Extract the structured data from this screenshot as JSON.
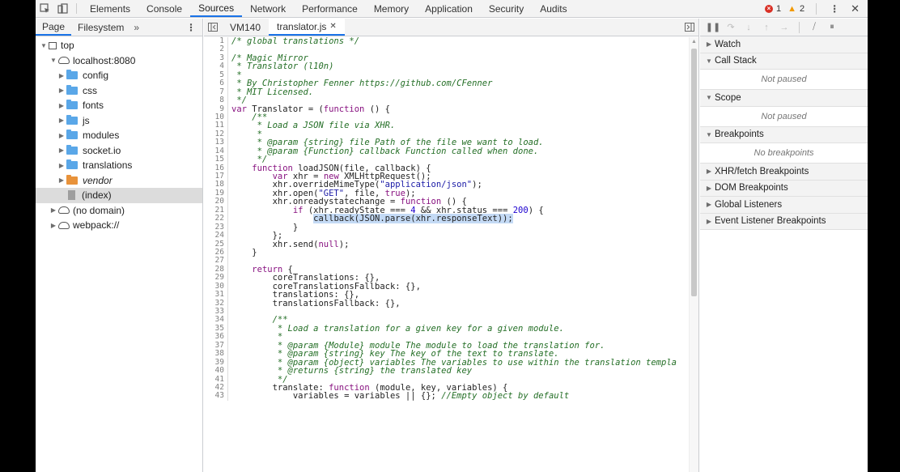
{
  "toolbar": {
    "tabs": [
      "Elements",
      "Console",
      "Sources",
      "Network",
      "Performance",
      "Memory",
      "Application",
      "Security",
      "Audits"
    ],
    "errors": "1",
    "warnings": "2"
  },
  "navigator": {
    "tabs": [
      "Page",
      "Filesystem"
    ],
    "more": "»",
    "tree": {
      "top": "top",
      "origin": "localhost:8080",
      "folders": [
        "config",
        "css",
        "fonts",
        "js",
        "modules",
        "socket.io",
        "translations",
        "vendor"
      ],
      "index": "(index)",
      "no_domain": "(no domain)",
      "webpack": "webpack://"
    }
  },
  "editor": {
    "tabs": [
      "VM140",
      "translator.js"
    ],
    "lines": [
      "/* global translations */",
      "",
      "/* Magic Mirror",
      " * Translator (l10n)",
      " *",
      " * By Christopher Fenner https://github.com/CFenner",
      " * MIT Licensed.",
      " */",
      "var Translator = (function () {",
      "    /**",
      "     * Load a JSON file via XHR.",
      "     *",
      "     * @param {string} file Path of the file we want to load.",
      "     * @param {Function} callback Function called when done.",
      "     */",
      "    function loadJSON(file, callback) {",
      "        var xhr = new XMLHttpRequest();",
      "        xhr.overrideMimeType(\"application/json\");",
      "        xhr.open(\"GET\", file, true);",
      "        xhr.onreadystatechange = function () {",
      "            if (xhr.readyState === 4 && xhr.status === 200) {",
      "                callback(JSON.parse(xhr.responseText));",
      "            }",
      "        };",
      "        xhr.send(null);",
      "    }",
      "",
      "    return {",
      "        coreTranslations: {},",
      "        coreTranslationsFallback: {},",
      "        translations: {},",
      "        translationsFallback: {},",
      "",
      "        /**",
      "         * Load a translation for a given key for a given module.",
      "         *",
      "         * @param {Module} module The module to load the translation for.",
      "         * @param {string} key The key of the text to translate.",
      "         * @param {object} variables The variables to use within the translation templa",
      "         * @returns {string} the translated key",
      "         */",
      "        translate: function (module, key, variables) {",
      "            variables = variables || {}; //Empty object by default"
    ]
  },
  "debugger": {
    "panes": [
      {
        "title": "Watch",
        "expanded": false,
        "body": ""
      },
      {
        "title": "Call Stack",
        "expanded": true,
        "body": "Not paused"
      },
      {
        "title": "Scope",
        "expanded": true,
        "body": "Not paused"
      },
      {
        "title": "Breakpoints",
        "expanded": true,
        "body": "No breakpoints"
      },
      {
        "title": "XHR/fetch Breakpoints",
        "expanded": false,
        "body": ""
      },
      {
        "title": "DOM Breakpoints",
        "expanded": false,
        "body": ""
      },
      {
        "title": "Global Listeners",
        "expanded": false,
        "body": ""
      },
      {
        "title": "Event Listener Breakpoints",
        "expanded": false,
        "body": ""
      }
    ]
  },
  "colors": {
    "accent": "#1a73e8",
    "comment": "#236e25",
    "keyword": "#881280",
    "string": "#1a1aa6",
    "highlight": "#c4daf5"
  }
}
